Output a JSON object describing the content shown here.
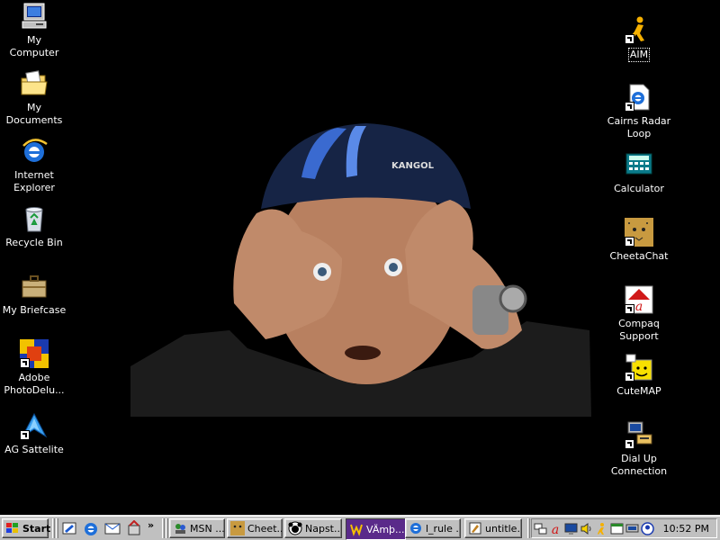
{
  "desktop": {
    "left_icons": [
      {
        "label": "My Computer",
        "icon": "my-computer-icon"
      },
      {
        "label": "My Documents",
        "icon": "my-documents-icon"
      },
      {
        "label": "Internet Explorer",
        "icon": "internet-explorer-icon"
      },
      {
        "label": "Recycle Bin",
        "icon": "recycle-bin-icon"
      },
      {
        "label": "My Briefcase",
        "icon": "briefcase-icon"
      },
      {
        "label": "Adobe PhotoDelu...",
        "icon": "adobe-photodeluxe-icon"
      },
      {
        "label": "AG Sattelite",
        "icon": "ag-sattelite-icon"
      }
    ],
    "right_icons": [
      {
        "label": "AIM",
        "icon": "aim-icon"
      },
      {
        "label": "Cairns Radar Loop",
        "icon": "ie-document-icon"
      },
      {
        "label": "Calculator",
        "icon": "calculator-icon"
      },
      {
        "label": "CheetaChat",
        "icon": "cheetah-icon"
      },
      {
        "label": "Compaq Support",
        "icon": "compaq-icon"
      },
      {
        "label": "CuteMAP",
        "icon": "cutemap-icon"
      },
      {
        "label": "Dial Up Connection",
        "icon": "dialup-icon"
      }
    ],
    "wallpaper_description": "photo-of-man-with-kangol-cap-making-goggle-hands",
    "background_color": "#000000"
  },
  "taskbar": {
    "start_label": "Start",
    "quick_launch": [
      "desktop-icon",
      "internet-explorer-icon",
      "outlook-icon",
      "channels-icon"
    ],
    "overflow": "»",
    "tasks": [
      {
        "label": "MSN ...",
        "icon": "msn-icon",
        "active": false
      },
      {
        "label": "Cheet...",
        "icon": "cheetah-icon",
        "active": false
      },
      {
        "label": "Napst...",
        "icon": "napster-icon",
        "active": false
      },
      {
        "label": "VÄmþ...",
        "icon": "winamp-icon",
        "active": true
      },
      {
        "label": "l_rule ...",
        "icon": "ie-icon",
        "active": false
      },
      {
        "label": "untitle...",
        "icon": "paint-icon",
        "active": false
      }
    ],
    "tray_icons": [
      "network-icon",
      "compaq-tray-icon",
      "display-icon",
      "volume-icon",
      "aim-tray-icon",
      "scheduler-icon",
      "monitor-icon",
      "user-icon"
    ],
    "clock": "10:52 PM",
    "active_color": "#5a2a8a"
  }
}
